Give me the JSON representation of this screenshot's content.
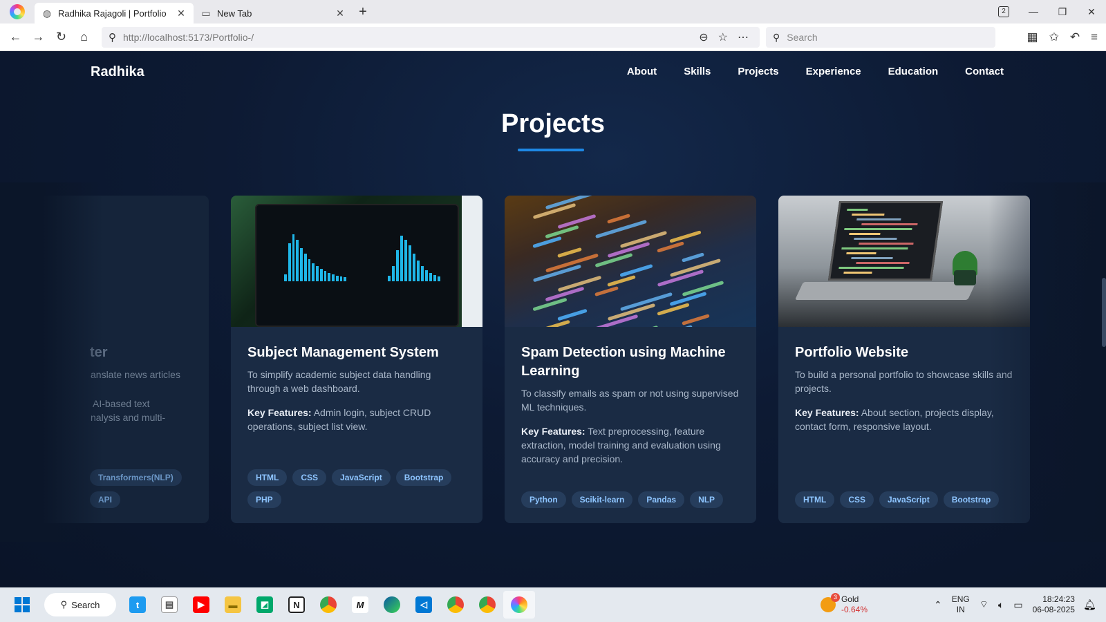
{
  "browser": {
    "tabs": [
      {
        "title": "Radhika Rajagoli | Portfolio",
        "active": true
      },
      {
        "title": "New Tab",
        "active": false
      }
    ],
    "tab_count": "2",
    "url": "http://localhost:5173/Portfolio-/",
    "search_placeholder": "Search"
  },
  "site": {
    "brand": "Radhika",
    "nav": [
      "About",
      "Skills",
      "Projects",
      "Experience",
      "Education",
      "Contact"
    ],
    "section_title": "Projects"
  },
  "projects": [
    {
      "title": "Subject Management System",
      "description": "To simplify academic subject data handling through a web dashboard.",
      "features_label": "Key Features:",
      "features": "Admin login, subject CRUD operations, subject list view.",
      "tags": [
        "HTML",
        "CSS",
        "JavaScript",
        "Bootstrap",
        "PHP"
      ],
      "image": "analytics-dashboard-image"
    },
    {
      "title": "Spam Detection using Machine Learning",
      "description": "To classify emails as spam or not using supervised ML techniques.",
      "features_label": "Key Features:",
      "features": "Text preprocessing, feature extraction, model training and evaluation using accuracy and precision.",
      "tags": [
        "Python",
        "Scikit-learn",
        "Pandas",
        "NLP"
      ],
      "image": "code-closeup-image"
    },
    {
      "title": "Portfolio Website",
      "description": "To build a personal portfolio to showcase skills and projects.",
      "features_label": "Key Features:",
      "features": "About section, projects display, contact form, responsive layout.",
      "tags": [
        "HTML",
        "CSS",
        "JavaScript",
        "Bootstrap"
      ],
      "image": "laptop-desk-image"
    }
  ],
  "partial_card": {
    "title_fragment": "ter",
    "line1": "anslate news articles",
    "line2": "AI-based text",
    "line3": "nalysis and multi-",
    "tags": [
      "Transformers(NLP)",
      "API"
    ]
  },
  "taskbar": {
    "search_label": "Search",
    "widget": {
      "name": "Gold",
      "change": "-0.64%",
      "badge": "3"
    },
    "lang": {
      "top": "ENG",
      "bottom": "IN"
    },
    "time": "18:24:23",
    "date": "06-08-2025"
  },
  "colors": {
    "accent": "#1e88e5",
    "page_bg": "#0b1528",
    "card_bg": "#1a2b44",
    "tag_text": "#8ec5ff"
  }
}
